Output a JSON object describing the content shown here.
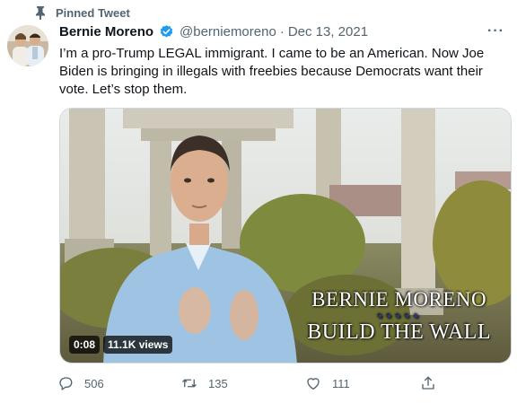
{
  "pinned_label": "Pinned Tweet",
  "author": {
    "name": "Bernie Moreno",
    "handle": "@berniemoreno",
    "separator": "·",
    "date": "Dec 13, 2021",
    "verified_color": "#1d9bf0"
  },
  "more_label": "···",
  "tweet_text": "I’m a pro-Trump LEGAL immigrant. I came to be an American. Now Joe Biden is bringing in illegals with freebies because Democrats want their vote. Let’s stop them.",
  "video": {
    "overlay_line1": "BERNIE MORENO",
    "overlay_stars": "★★★★★",
    "overlay_line2": "BUILD THE WALL",
    "duration": "0:08",
    "views": "11.1K views"
  },
  "actions": {
    "replies": "506",
    "retweets": "135",
    "likes": "111"
  },
  "icons": [
    "pin-icon",
    "verified-icon",
    "more-icon",
    "reply-icon",
    "retweet-icon",
    "like-icon",
    "share-icon"
  ]
}
